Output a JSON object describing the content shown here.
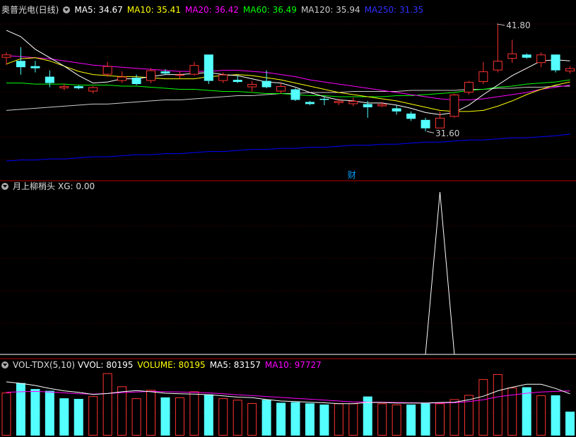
{
  "colors": {
    "up": "#ff3232",
    "down": "#54ffff",
    "ma5": "#ffffff",
    "ma10": "#ffff00",
    "ma20": "#ff00ff",
    "ma60": "#00ff00",
    "ma120": "#cccccc",
    "ma250": "#0000ff",
    "grid": "#5a0000",
    "signal": "#ffffff",
    "vol_ma5": "#ffffff",
    "vol_ma10": "#ff00ff"
  },
  "main": {
    "stock_name": "奥普光电(日线)",
    "icon": "chevron-down-icon",
    "ma": [
      {
        "text": "MA5: 34.67",
        "color": "#ffffff"
      },
      {
        "text": "MA10: 35.41",
        "color": "#ffff00"
      },
      {
        "text": "MA20: 36.42",
        "color": "#ff00ff"
      },
      {
        "text": "MA60: 36.49",
        "color": "#00ff00"
      },
      {
        "text": "MA120: 35.94",
        "color": "#cccccc"
      },
      {
        "text": "MA250: 31.35",
        "color": "#3030ff"
      }
    ],
    "high_label": "41.80",
    "low_label": "31.60",
    "finance_marker": "财"
  },
  "indicator": {
    "title": "月上柳梢头",
    "value_text": "XG: 0.00"
  },
  "volume": {
    "title": "VOL-TDX(5,10)",
    "items": [
      {
        "text": "VVOL: 80195",
        "color": "#ffffff"
      },
      {
        "text": "VOLUME: 80195",
        "color": "#ffff00"
      },
      {
        "text": "MA5: 83157",
        "color": "#ffffff"
      },
      {
        "text": "MA10: 97727",
        "color": "#ff00ff"
      }
    ]
  },
  "chart_data": [
    {
      "type": "candlestick",
      "title": "奥普光电(日线)",
      "candles": [
        {
          "o": 38.6,
          "h": 39.1,
          "l": 37.9,
          "c": 38.9
        },
        {
          "o": 38.3,
          "h": 39.6,
          "l": 37.0,
          "c": 37.7
        },
        {
          "o": 37.8,
          "h": 38.3,
          "l": 37.2,
          "c": 37.6
        },
        {
          "o": 36.8,
          "h": 37.4,
          "l": 35.8,
          "c": 36.2
        },
        {
          "o": 35.7,
          "h": 36.1,
          "l": 35.5,
          "c": 35.9
        },
        {
          "o": 35.9,
          "h": 36.0,
          "l": 35.6,
          "c": 35.7
        },
        {
          "o": 35.4,
          "h": 35.9,
          "l": 35.2,
          "c": 35.8
        },
        {
          "o": 37.0,
          "h": 38.2,
          "l": 36.8,
          "c": 37.8
        },
        {
          "o": 36.4,
          "h": 37.3,
          "l": 36.2,
          "c": 36.8
        },
        {
          "o": 36.7,
          "h": 37.0,
          "l": 36.0,
          "c": 36.1
        },
        {
          "o": 36.4,
          "h": 37.6,
          "l": 36.2,
          "c": 37.4
        },
        {
          "o": 37.3,
          "h": 37.5,
          "l": 37.0,
          "c": 37.1
        },
        {
          "o": 36.9,
          "h": 37.3,
          "l": 36.6,
          "c": 37.0
        },
        {
          "o": 37.0,
          "h": 38.2,
          "l": 36.9,
          "c": 37.9
        },
        {
          "o": 38.9,
          "h": 38.9,
          "l": 36.1,
          "c": 36.4
        },
        {
          "o": 36.4,
          "h": 37.2,
          "l": 36.2,
          "c": 37.0
        },
        {
          "o": 36.5,
          "h": 36.9,
          "l": 36.2,
          "c": 36.3
        },
        {
          "o": 35.8,
          "h": 36.4,
          "l": 35.4,
          "c": 36.1
        },
        {
          "o": 36.4,
          "h": 37.4,
          "l": 35.7,
          "c": 35.8
        },
        {
          "o": 35.4,
          "h": 36.2,
          "l": 35.2,
          "c": 35.9
        },
        {
          "o": 35.6,
          "h": 35.7,
          "l": 34.5,
          "c": 34.6
        },
        {
          "o": 34.4,
          "h": 34.5,
          "l": 34.1,
          "c": 34.2
        },
        {
          "o": 34.7,
          "h": 34.9,
          "l": 34.1,
          "c": 34.6
        },
        {
          "o": 34.3,
          "h": 34.7,
          "l": 34.1,
          "c": 34.5
        },
        {
          "o": 34.2,
          "h": 34.8,
          "l": 34.0,
          "c": 34.5
        },
        {
          "o": 34.2,
          "h": 34.5,
          "l": 32.9,
          "c": 33.9
        },
        {
          "o": 34.0,
          "h": 34.4,
          "l": 33.9,
          "c": 34.2
        },
        {
          "o": 33.8,
          "h": 34.1,
          "l": 33.2,
          "c": 33.5
        },
        {
          "o": 33.3,
          "h": 33.5,
          "l": 32.6,
          "c": 32.8
        },
        {
          "o": 32.7,
          "h": 32.9,
          "l": 31.6,
          "c": 31.9
        },
        {
          "o": 31.9,
          "h": 33.5,
          "l": 31.9,
          "c": 32.9
        },
        {
          "o": 33.0,
          "h": 35.2,
          "l": 32.9,
          "c": 35.1
        },
        {
          "o": 35.3,
          "h": 36.4,
          "l": 35.1,
          "c": 36.3
        },
        {
          "o": 36.3,
          "h": 38.2,
          "l": 36.1,
          "c": 37.3
        },
        {
          "o": 37.4,
          "h": 41.8,
          "l": 37.2,
          "c": 38.3
        },
        {
          "o": 38.5,
          "h": 40.3,
          "l": 38.1,
          "c": 39.0
        },
        {
          "o": 38.9,
          "h": 39.0,
          "l": 38.5,
          "c": 38.6
        },
        {
          "o": 38.1,
          "h": 39.1,
          "l": 37.7,
          "c": 38.9
        },
        {
          "o": 38.9,
          "h": 38.9,
          "l": 37.2,
          "c": 37.4
        },
        {
          "o": 37.3,
          "h": 37.8,
          "l": 37.1,
          "c": 37.6
        }
      ],
      "ma5": [
        41.2,
        40.6,
        39.4,
        38.6,
        37.8,
        36.9,
        36.2,
        36.3,
        36.6,
        36.6,
        36.8,
        37.0,
        37.0,
        37.1,
        37.2,
        37.0,
        36.9,
        36.6,
        36.3,
        36.2,
        35.8,
        35.3,
        34.9,
        34.6,
        34.5,
        34.3,
        34.3,
        34.1,
        33.8,
        33.4,
        33.2,
        33.4,
        34.1,
        35.1,
        36.0,
        36.9,
        37.6,
        38.3,
        38.4,
        38.3
      ],
      "ma10": [
        38.0,
        38.5,
        38.6,
        38.3,
        37.8,
        37.3,
        37.0,
        36.9,
        36.8,
        36.8,
        36.7,
        36.6,
        36.6,
        36.6,
        36.8,
        36.9,
        37.0,
        36.9,
        36.7,
        36.5,
        36.2,
        35.9,
        35.6,
        35.3,
        35.1,
        34.9,
        34.7,
        34.5,
        34.2,
        33.9,
        33.6,
        33.5,
        33.5,
        33.6,
        34.0,
        34.5,
        35.1,
        35.6,
        36.0,
        36.3
      ],
      "ma20": [
        38.8,
        38.7,
        38.6,
        38.5,
        38.3,
        38.1,
        37.9,
        37.8,
        37.7,
        37.6,
        37.5,
        37.4,
        37.3,
        37.3,
        37.3,
        37.4,
        37.4,
        37.3,
        37.2,
        37.0,
        36.8,
        36.5,
        36.3,
        36.1,
        35.9,
        35.7,
        35.5,
        35.3,
        35.1,
        34.9,
        34.7,
        34.6,
        34.6,
        34.7,
        34.9,
        35.1,
        35.3,
        35.6,
        35.8,
        36.0
      ],
      "ma60": [
        36.2,
        36.2,
        36.1,
        36.1,
        36.1,
        36.0,
        36.0,
        36.0,
        35.9,
        35.9,
        35.8,
        35.7,
        35.6,
        35.6,
        35.5,
        35.4,
        35.4,
        35.3,
        35.2,
        35.2,
        35.1,
        35.0,
        35.0,
        34.9,
        34.9,
        34.9,
        34.9,
        35.0,
        35.0,
        35.1,
        35.2,
        35.3,
        35.5,
        35.6,
        35.8,
        35.9,
        36.1,
        36.2,
        36.3,
        36.5
      ],
      "ma120": [
        33.6,
        33.7,
        33.8,
        33.9,
        34.0,
        34.1,
        34.2,
        34.2,
        34.3,
        34.4,
        34.5,
        34.6,
        34.6,
        34.7,
        34.8,
        34.9,
        35.0,
        35.0,
        35.1,
        35.2,
        35.2,
        35.3,
        35.3,
        35.3,
        35.4,
        35.4,
        35.4,
        35.4,
        35.5,
        35.5,
        35.5,
        35.5,
        35.6,
        35.6,
        35.7,
        35.7,
        35.8,
        35.8,
        35.9,
        35.9
      ],
      "ma250": [
        28.8,
        28.9,
        28.9,
        29.0,
        29.0,
        29.1,
        29.2,
        29.2,
        29.3,
        29.4,
        29.4,
        29.5,
        29.5,
        29.6,
        29.7,
        29.7,
        29.8,
        29.9,
        29.9,
        30.0,
        30.0,
        30.1,
        30.1,
        30.2,
        30.3,
        30.3,
        30.4,
        30.4,
        30.5,
        30.6,
        30.6,
        30.7,
        30.8,
        30.8,
        30.9,
        31.0,
        31.0,
        31.1,
        31.2,
        31.35
      ],
      "ylim": [
        28.0,
        42.6
      ]
    },
    {
      "type": "line",
      "title": "月上柳梢头",
      "series": [
        {
          "name": "XG",
          "values": [
            0,
            0,
            0,
            0,
            0,
            0,
            0,
            0,
            0,
            0,
            0,
            0,
            0,
            0,
            0,
            0,
            0,
            0,
            0,
            0,
            0,
            0,
            0,
            0,
            0,
            0,
            0,
            0,
            0,
            0,
            1,
            0,
            0,
            0,
            0,
            0,
            0,
            0,
            0,
            0
          ]
        }
      ],
      "ylim": [
        0,
        1
      ]
    },
    {
      "type": "bar",
      "title": "VOL-TDX(5,10)",
      "values": [
        144000,
        176000,
        156000,
        150000,
        125000,
        123000,
        132000,
        209000,
        165000,
        125000,
        153000,
        128000,
        128000,
        148000,
        138000,
        125000,
        120000,
        109000,
        120000,
        110000,
        112000,
        108000,
        104000,
        108000,
        108000,
        131000,
        108000,
        104000,
        104000,
        108000,
        108000,
        122000,
        136000,
        189000,
        206000,
        161000,
        162000,
        135000,
        135000,
        80195
      ],
      "up": [
        true,
        false,
        false,
        false,
        false,
        false,
        true,
        true,
        true,
        true,
        true,
        false,
        true,
        true,
        false,
        true,
        true,
        true,
        false,
        false,
        false,
        false,
        false,
        true,
        true,
        false,
        true,
        true,
        false,
        false,
        true,
        true,
        true,
        true,
        true,
        true,
        false,
        true,
        false,
        false
      ],
      "ma5": [
        180000,
        175000,
        168000,
        158000,
        150000,
        145000,
        138000,
        141000,
        147000,
        151000,
        147000,
        142000,
        140000,
        139000,
        137000,
        133000,
        129000,
        127000,
        121000,
        116000,
        114000,
        112000,
        110000,
        107000,
        107000,
        111000,
        111000,
        109000,
        109000,
        109000,
        111000,
        112000,
        120000,
        132000,
        150000,
        162000,
        172000,
        172000,
        158000,
        140000
      ],
      "ma10": [
        145000,
        147000,
        148000,
        146000,
        143000,
        140000,
        139000,
        141000,
        144000,
        146000,
        148000,
        147000,
        146000,
        145000,
        143000,
        140000,
        137000,
        134000,
        131000,
        128000,
        125000,
        122000,
        119000,
        116000,
        113000,
        112000,
        112000,
        111000,
        110000,
        109000,
        109000,
        110000,
        114000,
        120000,
        130000,
        136000,
        142000,
        146000,
        148000,
        150000
      ],
      "ylim": [
        0,
        220000
      ]
    }
  ]
}
